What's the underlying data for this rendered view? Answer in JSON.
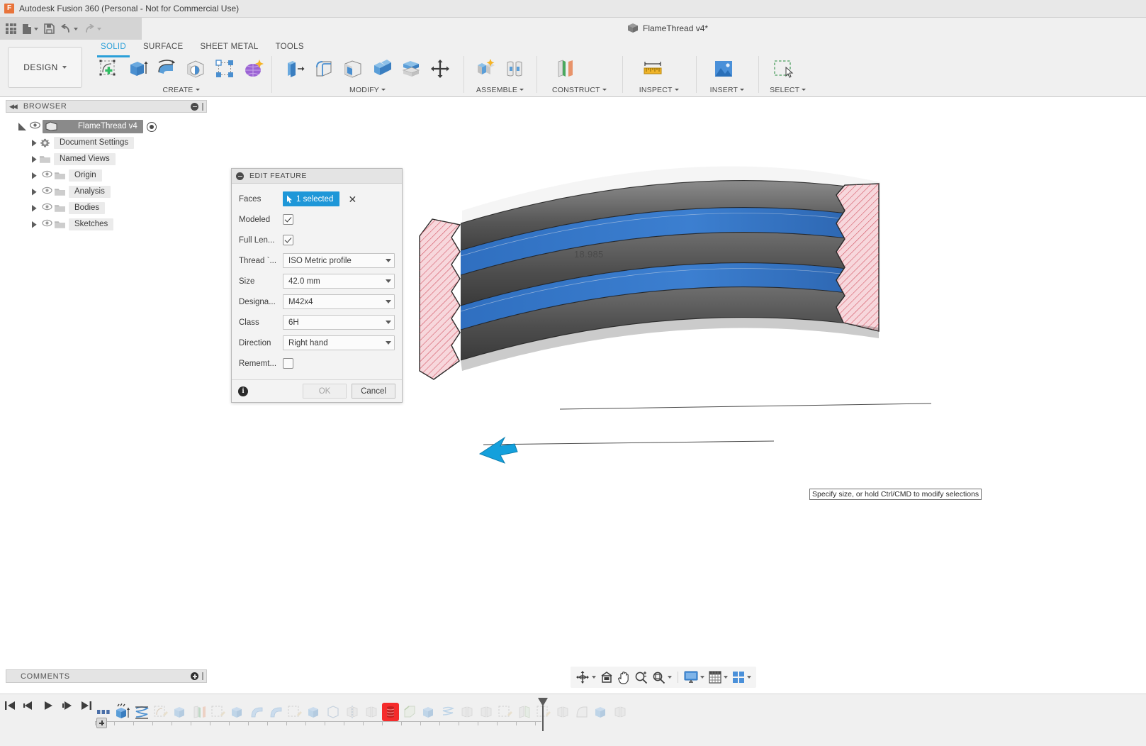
{
  "titlebar": {
    "app_title": "Autodesk Fusion 360 (Personal - Not for Commercial Use)",
    "logo_glyph": "F",
    "document_tab": "FlameThread v4*"
  },
  "quick_access": {
    "items": [
      {
        "name": "app-grid-button",
        "tooltip": "Show Data Panel"
      },
      {
        "name": "file-button",
        "tooltip": "File"
      },
      {
        "name": "save-button",
        "tooltip": "Save"
      },
      {
        "name": "undo-button",
        "tooltip": "Undo"
      },
      {
        "name": "redo-button",
        "tooltip": "Redo"
      }
    ]
  },
  "ribbon": {
    "workspace_label": "DESIGN",
    "tabs": [
      {
        "label": "SOLID",
        "active": true
      },
      {
        "label": "SURFACE",
        "active": false
      },
      {
        "label": "SHEET METAL",
        "active": false
      },
      {
        "label": "TOOLS",
        "active": false
      }
    ],
    "panels": [
      {
        "label": "CREATE",
        "has_dropdown": true,
        "icons": [
          "create-sketch-icon",
          "extrude-icon",
          "revolve-icon",
          "sweep-icon",
          "pattern-icon",
          "form-icon"
        ]
      },
      {
        "label": "MODIFY",
        "has_dropdown": true,
        "icons": [
          "press-pull-icon",
          "fillet-icon",
          "shell-icon",
          "combine-icon",
          "split-face-icon",
          "move-copy-icon"
        ]
      },
      {
        "label": "ASSEMBLE",
        "has_dropdown": true,
        "icons": [
          "new-component-icon",
          "joint-icon"
        ]
      },
      {
        "label": "CONSTRUCT",
        "has_dropdown": true,
        "icons": [
          "offset-plane-icon"
        ]
      },
      {
        "label": "INSPECT",
        "has_dropdown": true,
        "icons": [
          "measure-icon"
        ]
      },
      {
        "label": "INSERT",
        "has_dropdown": true,
        "icons": [
          "insert-image-icon"
        ]
      },
      {
        "label": "SELECT",
        "has_dropdown": true,
        "icons": [
          "select-window-icon"
        ]
      }
    ]
  },
  "browser": {
    "header": "BROWSER",
    "nodes": [
      {
        "label": "FlameThread v4",
        "icon": "component-icon",
        "selected": true,
        "expanded": true,
        "has_eye": true,
        "has_radio": true,
        "indent": 0
      },
      {
        "label": "Document Settings",
        "icon": "gear-icon",
        "selected": false,
        "expanded": false,
        "has_eye": false,
        "has_radio": false,
        "indent": 1
      },
      {
        "label": "Named Views",
        "icon": "folder-icon",
        "selected": false,
        "expanded": false,
        "has_eye": false,
        "has_radio": false,
        "indent": 1
      },
      {
        "label": "Origin",
        "icon": "folder-icon",
        "selected": false,
        "expanded": false,
        "has_eye": true,
        "has_radio": false,
        "indent": 1
      },
      {
        "label": "Analysis",
        "icon": "folder-icon",
        "selected": false,
        "expanded": false,
        "has_eye": true,
        "has_radio": false,
        "indent": 1
      },
      {
        "label": "Bodies",
        "icon": "folder-icon",
        "selected": false,
        "expanded": false,
        "has_eye": true,
        "has_radio": false,
        "indent": 1
      },
      {
        "label": "Sketches",
        "icon": "folder-icon",
        "selected": false,
        "expanded": false,
        "has_eye": true,
        "has_radio": false,
        "indent": 1
      }
    ]
  },
  "dialog": {
    "title": "EDIT FEATURE",
    "rows": [
      {
        "label": "Faces",
        "type": "selection",
        "value": "1 selected"
      },
      {
        "label": "Modeled",
        "type": "checkbox",
        "checked": true
      },
      {
        "label": "Full Len...",
        "type": "checkbox",
        "checked": true
      },
      {
        "label": "Thread `...",
        "type": "combo",
        "value": "ISO Metric profile"
      },
      {
        "label": "Size",
        "type": "combo",
        "value": "42.0 mm"
      },
      {
        "label": "Designa...",
        "type": "combo",
        "value": "M42x4"
      },
      {
        "label": "Class",
        "type": "combo",
        "value": "6H"
      },
      {
        "label": "Direction",
        "type": "combo",
        "value": "Right hand"
      },
      {
        "label": "Rememt...",
        "type": "checkbox",
        "checked": false
      }
    ],
    "ok_label": "OK",
    "cancel_label": "Cancel",
    "ok_disabled": true,
    "accent_color": "#1e97d8"
  },
  "canvas": {
    "dimension_label": "18.985",
    "tooltip": "Specify size, or hold Ctrl/CMD to modify selections",
    "model_colors": {
      "section_fill": "#f7d7dc",
      "section_hatch": "#d04a5a",
      "thread_highlight": "#2f6fc0",
      "body_dark": "#4a4a4a",
      "arrow": "#14a0dc"
    }
  },
  "comments": {
    "header": "COMMENTS"
  },
  "navbar": {
    "items": [
      {
        "name": "orbit-button",
        "label": "Orbit",
        "has_dropdown": true
      },
      {
        "name": "look-at-button",
        "label": "Look At",
        "has_dropdown": false
      },
      {
        "name": "pan-button",
        "label": "Pan",
        "has_dropdown": false
      },
      {
        "name": "zoom-button",
        "label": "Zoom",
        "has_dropdown": false
      },
      {
        "name": "fit-button",
        "label": "Fit",
        "has_dropdown": true
      },
      {
        "name": "display-settings-button",
        "label": "Display Settings",
        "has_dropdown": true
      },
      {
        "name": "grid-snaps-button",
        "label": "Grid and Snaps",
        "has_dropdown": true
      },
      {
        "name": "viewports-button",
        "label": "Viewports",
        "has_dropdown": true
      }
    ]
  },
  "timeline": {
    "playback": [
      {
        "name": "timeline-go-start-button"
      },
      {
        "name": "timeline-step-back-button"
      },
      {
        "name": "timeline-play-button"
      },
      {
        "name": "timeline-step-forward-button"
      },
      {
        "name": "timeline-go-end-button"
      }
    ],
    "features": [
      {
        "name": "timeline-feature-params",
        "icon": "parameters-icon",
        "state": "active",
        "selected": false
      },
      {
        "name": "timeline-feature-extrude",
        "icon": "extrude-icon",
        "state": "active",
        "selected": false
      },
      {
        "name": "timeline-feature-coil",
        "icon": "coil-icon",
        "state": "active",
        "selected": false
      },
      {
        "name": "timeline-feature-sketch",
        "icon": "sketch-icon",
        "state": "dim",
        "selected": false
      },
      {
        "name": "timeline-feature-extrude-2",
        "icon": "extrude-icon",
        "state": "dim",
        "selected": false
      },
      {
        "name": "timeline-feature-plane",
        "icon": "plane-icon",
        "state": "dim",
        "selected": false
      },
      {
        "name": "timeline-feature-sketch-2",
        "icon": "sketch-icon",
        "state": "dim",
        "selected": false
      },
      {
        "name": "timeline-feature-extrude-3",
        "icon": "extrude-icon",
        "state": "dim",
        "selected": false
      },
      {
        "name": "timeline-feature-sweep",
        "icon": "sweep-icon",
        "state": "dim",
        "selected": false
      },
      {
        "name": "timeline-feature-sweep-2",
        "icon": "sweep-icon",
        "state": "dim",
        "selected": false
      },
      {
        "name": "timeline-feature-sketch-3",
        "icon": "sketch-icon",
        "state": "dim",
        "selected": false
      },
      {
        "name": "timeline-feature-extrude-4",
        "icon": "extrude-icon",
        "state": "dim",
        "selected": false
      },
      {
        "name": "timeline-feature-body",
        "icon": "body-icon",
        "state": "dim",
        "selected": false
      },
      {
        "name": "timeline-feature-mirror",
        "icon": "mirror-icon",
        "state": "dim",
        "selected": false
      },
      {
        "name": "timeline-feature-mirror-2",
        "icon": "mirror-icon",
        "state": "dim",
        "selected": false
      },
      {
        "name": "timeline-feature-thread",
        "icon": "thread-icon",
        "state": "active",
        "selected": true
      },
      {
        "name": "timeline-feature-chamfer",
        "icon": "chamfer-icon",
        "state": "dim",
        "selected": false
      },
      {
        "name": "timeline-feature-extrude-5",
        "icon": "extrude-icon",
        "state": "dim",
        "selected": false
      },
      {
        "name": "timeline-feature-coil-2",
        "icon": "coil-icon",
        "state": "dim",
        "selected": false
      },
      {
        "name": "timeline-feature-mirror-3",
        "icon": "mirror-icon",
        "state": "dim",
        "selected": false
      },
      {
        "name": "timeline-feature-mirror-4",
        "icon": "mirror-icon",
        "state": "dim",
        "selected": false
      },
      {
        "name": "timeline-feature-sketch-4",
        "icon": "sketch-icon",
        "state": "dim",
        "selected": false
      },
      {
        "name": "timeline-feature-sweep-3",
        "icon": "sweep-icon",
        "state": "dim",
        "selected": false
      },
      {
        "name": "timeline-feature-sketch-5",
        "icon": "sketch-icon",
        "state": "dim",
        "selected": false
      },
      {
        "name": "timeline-feature-mirror-5",
        "icon": "mirror-icon",
        "state": "dim",
        "selected": false
      },
      {
        "name": "timeline-feature-revolve",
        "icon": "revolve-icon",
        "state": "dim",
        "selected": false
      },
      {
        "name": "timeline-feature-extrude-6",
        "icon": "extrude-icon",
        "state": "dim",
        "selected": false
      },
      {
        "name": "timeline-feature-mirror-6",
        "icon": "mirror-icon",
        "state": "dim",
        "selected": false
      }
    ]
  }
}
